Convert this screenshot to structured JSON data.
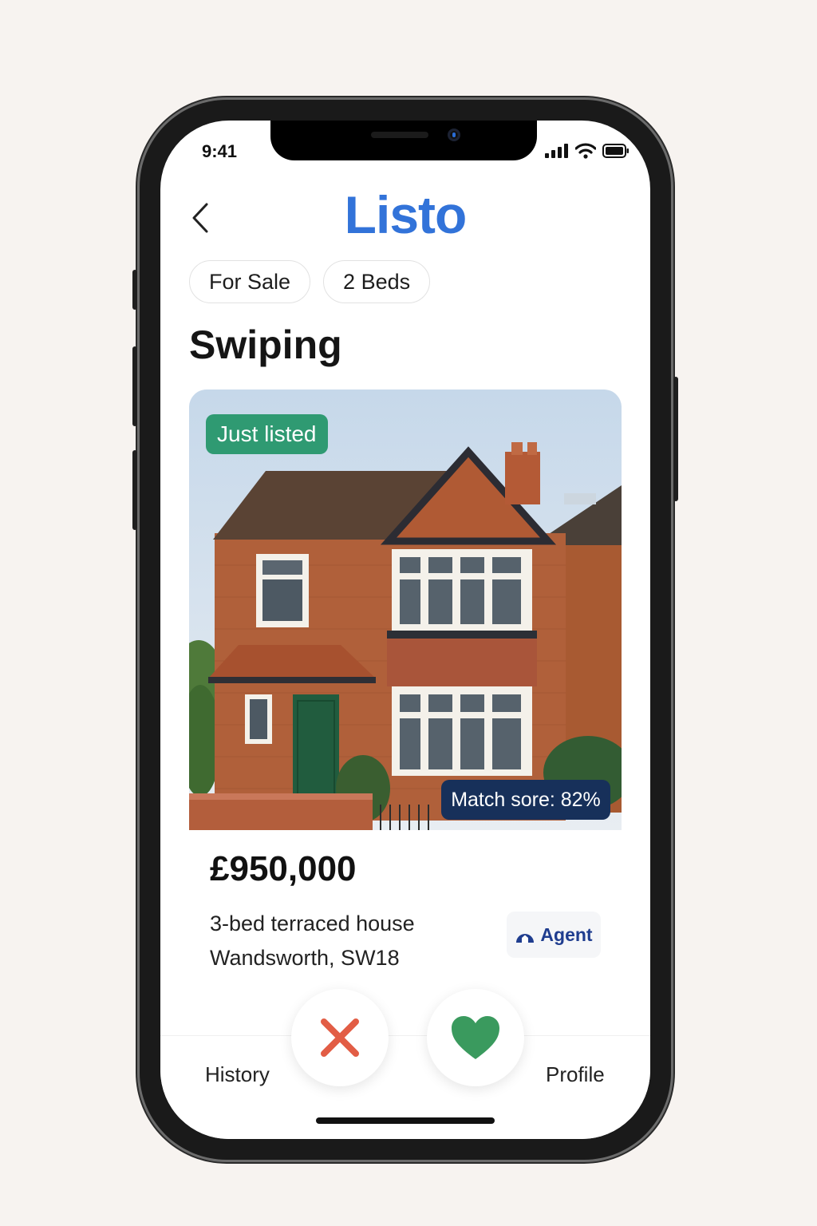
{
  "status_bar": {
    "time": "9:41"
  },
  "header": {
    "brand": "Listo",
    "back_icon": "chevron-left-icon"
  },
  "filters": [
    {
      "label": "For Sale"
    },
    {
      "label": "2 Beds"
    }
  ],
  "section": {
    "title": "Swiping"
  },
  "listing": {
    "badge": "Just listed",
    "match": "Match sore: 82%",
    "price": "£950,000",
    "description": "3-bed terraced house",
    "location": "Wandsworth, SW18",
    "agent_label": "Agent"
  },
  "actions": {
    "dislike_icon": "close-icon",
    "like_icon": "heart-icon"
  },
  "tab_bar": {
    "left": "History",
    "right": "Profile"
  },
  "colors": {
    "brand": "#3273d9",
    "badge_green": "#2f9a72",
    "match_bg": "#17305a",
    "dislike": "#e25d45",
    "like": "#3a9a5e"
  }
}
